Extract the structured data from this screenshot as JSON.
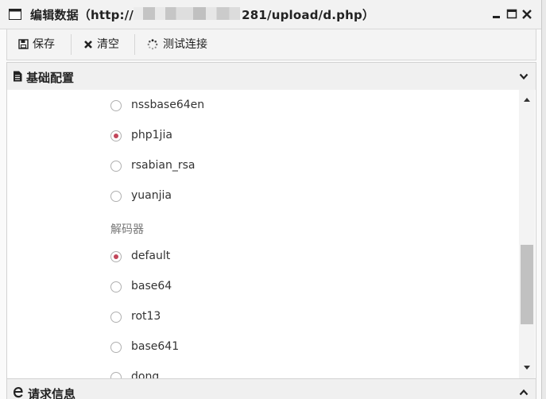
{
  "window": {
    "title_prefix": "编辑数据（http://",
    "title_suffix": "281/upload/d.php）"
  },
  "toolbar": {
    "save_label": "保存",
    "clear_label": "清空",
    "test_label": "测试连接"
  },
  "sections": {
    "basic_config": "基础配置",
    "request_info": "请求信息"
  },
  "options": {
    "encoders": [
      {
        "label": "nssbase64en",
        "checked": false
      },
      {
        "label": "php1jia",
        "checked": true
      },
      {
        "label": "rsabian_rsa",
        "checked": false
      },
      {
        "label": "yuanjia",
        "checked": false
      }
    ],
    "decoder_group_label": "解码器",
    "decoders": [
      {
        "label": "default",
        "checked": true
      },
      {
        "label": "base64",
        "checked": false
      },
      {
        "label": "rot13",
        "checked": false
      },
      {
        "label": "base641",
        "checked": false
      },
      {
        "label": "dong",
        "checked": false
      }
    ]
  },
  "colors": {
    "radio_checked": "#c2465a",
    "panel_bg": "#f0f0f0"
  }
}
